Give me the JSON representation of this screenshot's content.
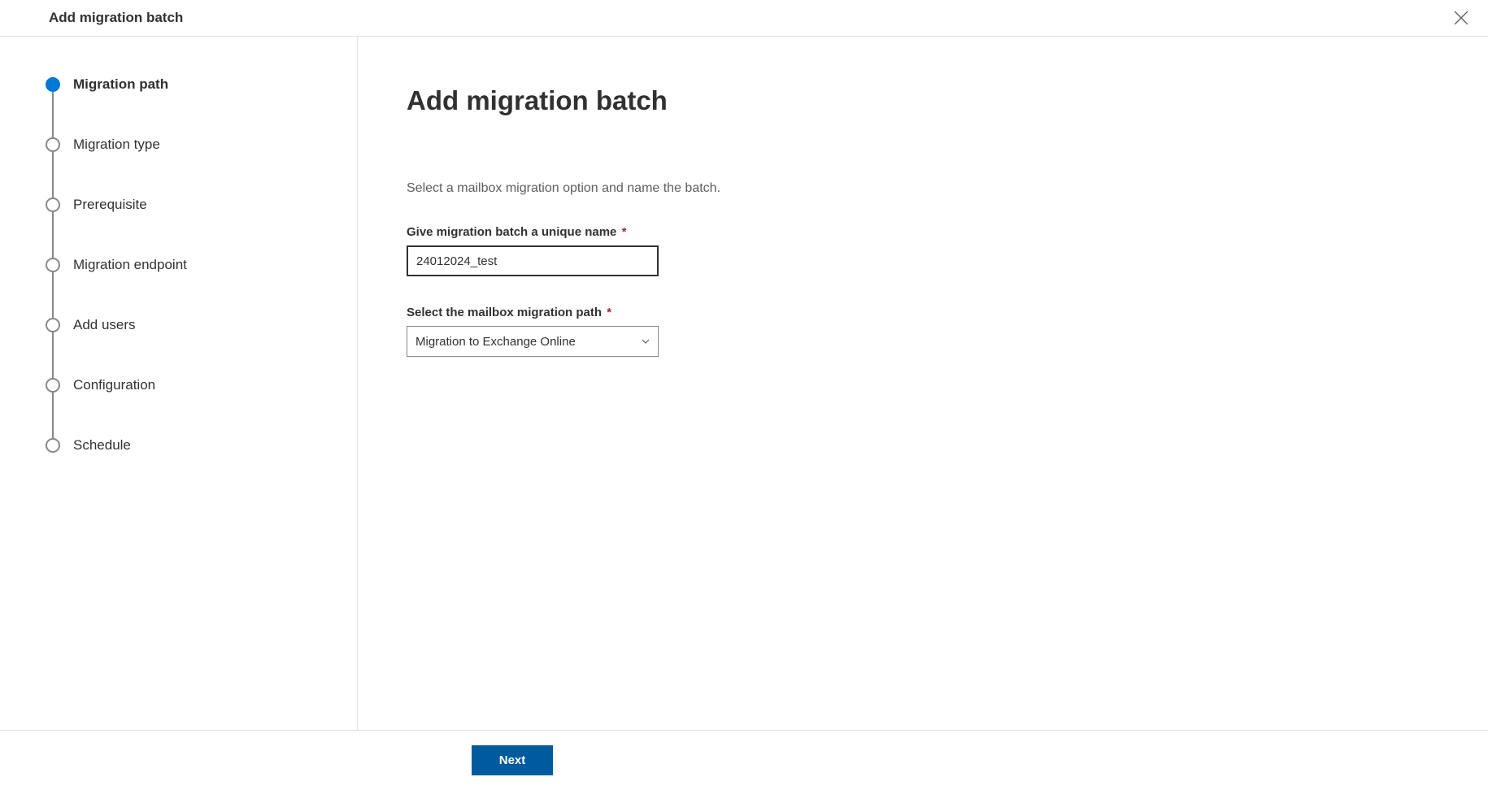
{
  "header": {
    "title": "Add migration batch"
  },
  "sidebar": {
    "steps": [
      {
        "label": "Migration path",
        "active": true
      },
      {
        "label": "Migration type",
        "active": false
      },
      {
        "label": "Prerequisite",
        "active": false
      },
      {
        "label": "Migration endpoint",
        "active": false
      },
      {
        "label": "Add users",
        "active": false
      },
      {
        "label": "Configuration",
        "active": false
      },
      {
        "label": "Schedule",
        "active": false
      }
    ]
  },
  "main": {
    "title": "Add migration batch",
    "description": "Select a mailbox migration option and name the batch.",
    "batch_name_label": "Give migration batch a unique name",
    "batch_name_value": "24012024_test",
    "migration_path_label": "Select the mailbox migration path",
    "migration_path_value": "Migration to Exchange Online"
  },
  "footer": {
    "next_label": "Next"
  }
}
